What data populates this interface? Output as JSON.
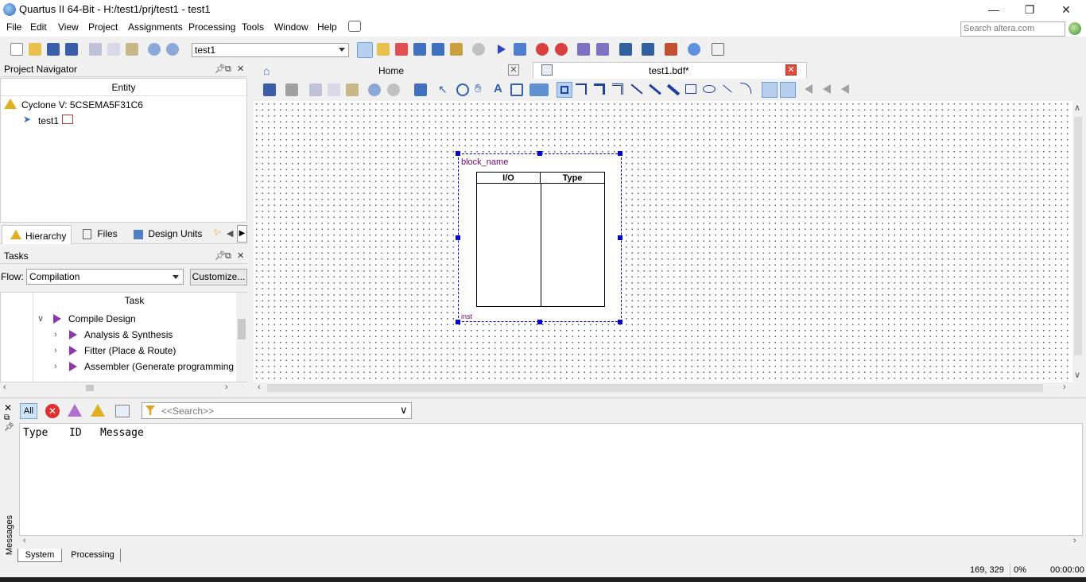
{
  "window": {
    "title": "Quartus II 64-Bit - H:/test1/prj/test1 - test1",
    "minimize": "—",
    "restore": "❐",
    "close": "✕"
  },
  "menu": [
    "File",
    "Edit",
    "View",
    "Project",
    "Assignments",
    "Processing",
    "Tools",
    "Window",
    "Help"
  ],
  "search": {
    "placeholder": "Search altera.com"
  },
  "toolbar": {
    "project_select": "test1"
  },
  "project_navigator": {
    "title": "Project Navigator",
    "column": "Entity",
    "device": "Cyclone V: 5CSEMA5F31C6",
    "entity": "test1",
    "tabs": [
      "Hierarchy",
      "Files",
      "Design Units"
    ]
  },
  "tasks": {
    "title": "Tasks",
    "flow_label": "Flow:",
    "flow_value": "Compilation",
    "customize": "Customize...",
    "column": "Task",
    "items": [
      "Compile Design",
      "Analysis & Synthesis",
      "Fitter (Place & Route)",
      "Assembler (Generate programming files)"
    ]
  },
  "editor": {
    "tabs": [
      "Home",
      "test1.bdf*"
    ],
    "block": {
      "name": "block_name",
      "inst": "inst",
      "col_io": "I/O",
      "col_type": "Type"
    }
  },
  "messages": {
    "filter_all": "All",
    "search_placeholder": "<<Search>>",
    "columns": [
      "Type",
      "ID",
      "Message"
    ],
    "side_label": "Messages",
    "tabs": [
      "System",
      "Processing"
    ]
  },
  "status": {
    "coords": "169, 329",
    "percent": "0%",
    "time": "00:00:00"
  },
  "colors": {
    "accent": "#0000d0",
    "block_text": "#7a0070",
    "close_red": "#e04a3a"
  }
}
